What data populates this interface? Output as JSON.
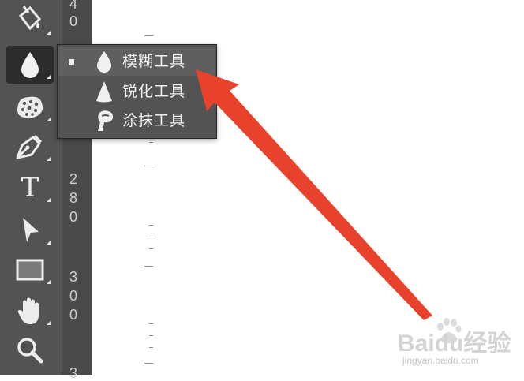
{
  "toolbar": {
    "tools": [
      {
        "name": "paint-bucket-tool",
        "icon": "paint-bucket-icon"
      },
      {
        "name": "blur-tool",
        "icon": "droplet-icon",
        "active": true
      },
      {
        "name": "sponge-tool",
        "icon": "sponge-icon"
      },
      {
        "name": "pen-tool",
        "icon": "pen-nib-icon"
      },
      {
        "name": "type-tool",
        "icon": "type-icon",
        "glyph": "T"
      },
      {
        "name": "path-selection-tool",
        "icon": "arrow-cursor-icon"
      },
      {
        "name": "rectangle-tool",
        "icon": "rectangle-icon"
      },
      {
        "name": "hand-tool",
        "icon": "hand-icon"
      },
      {
        "name": "zoom-tool",
        "icon": "magnifier-icon"
      }
    ]
  },
  "ruler": {
    "digits": [
      "4",
      "0",
      "2",
      "8",
      "0",
      "3",
      "0",
      "0",
      "3"
    ]
  },
  "flyout": {
    "items": [
      {
        "label": "模糊工具",
        "icon": "droplet-icon",
        "selected": true
      },
      {
        "label": "锐化工具",
        "icon": "cone-icon",
        "selected": false
      },
      {
        "label": "涂抹工具",
        "icon": "finger-icon",
        "selected": false
      }
    ]
  },
  "annotation": {
    "color": "#e8412c",
    "icon": "red-arrow-icon"
  },
  "watermark": {
    "text": "Baidu经验",
    "url": "jingyan.baidu.com"
  },
  "colors": {
    "panel": "#535353",
    "ruler": "#4a4a4a",
    "canvas": "#ffffff",
    "accent": "#e8412c"
  }
}
